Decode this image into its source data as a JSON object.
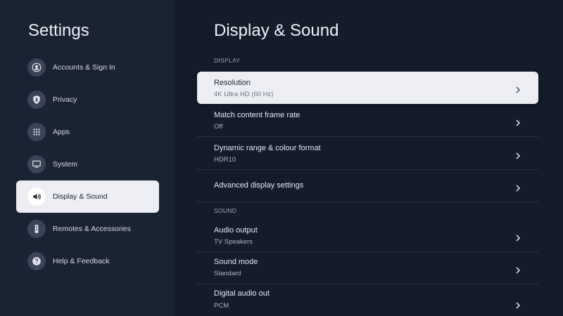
{
  "sidebar": {
    "title": "Settings",
    "items": [
      {
        "label": "Accounts & Sign In",
        "icon": "account-icon"
      },
      {
        "label": "Privacy",
        "icon": "shield-icon"
      },
      {
        "label": "Apps",
        "icon": "apps-grid-icon"
      },
      {
        "label": "System",
        "icon": "monitor-icon"
      },
      {
        "label": "Display & Sound",
        "icon": "speaker-icon",
        "selected": true
      },
      {
        "label": "Remotes & Accessories",
        "icon": "remote-icon"
      },
      {
        "label": "Help & Feedback",
        "icon": "help-icon"
      }
    ]
  },
  "main": {
    "title": "Display & Sound",
    "sections": {
      "display": "DISPLAY",
      "sound": "SOUND"
    },
    "rows": [
      {
        "title": "Resolution",
        "value": "4K Ultra HD (60 Hz)",
        "focused": true
      },
      {
        "title": "Match content frame rate",
        "value": "Off"
      },
      {
        "title": "Dynamic range & colour format",
        "value": "HDR10"
      },
      {
        "title": "Advanced display settings",
        "value": ""
      },
      {
        "title": "Audio output",
        "value": "TV Speakers"
      },
      {
        "title": "Sound mode",
        "value": "Standard"
      },
      {
        "title": "Digital audio out",
        "value": "PCM"
      }
    ]
  },
  "colors": {
    "background": "#141c2c",
    "sidebar": "#1a2334",
    "selected": "#eceef3"
  }
}
